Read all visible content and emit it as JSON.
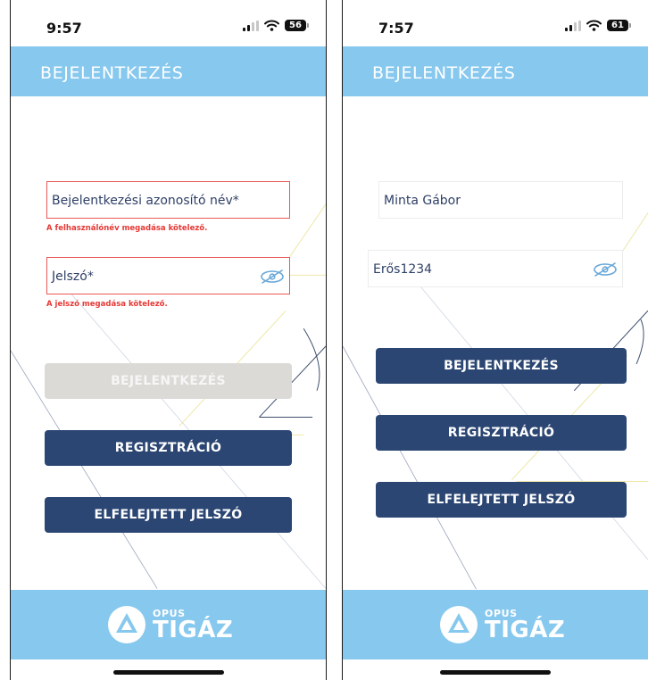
{
  "colors": {
    "header_bg": "#87c8ee",
    "button_primary": "#2b4673",
    "button_disabled": "#dcdad6",
    "error": "#e53935",
    "input_text": "#2e3f66"
  },
  "left": {
    "status": {
      "time": "9:57",
      "battery": "56"
    },
    "header": {
      "title": "BEJELENTKEZÉS"
    },
    "username": {
      "value": "Bejelentkezési azonosító név*",
      "error": "A felhasználónév megadása kötelező."
    },
    "password": {
      "value": "Jelszó*",
      "error": "A jelszó megadása kötelező.",
      "icon": "eye-slash-icon"
    },
    "buttons": {
      "login": "BEJELENTKEZÉS",
      "register": "REGISZTRÁCIÓ",
      "forgot": "ELFELEJTETT JELSZÓ"
    },
    "footer": {
      "logo_small": "OPUS",
      "logo_big": "TIGÁZ"
    }
  },
  "right": {
    "status": {
      "time": "7:57",
      "battery": "61"
    },
    "header": {
      "title": "BEJELENTKEZÉS"
    },
    "username": {
      "value": "Minta Gábor"
    },
    "password": {
      "value": "Erős1234",
      "icon": "eye-slash-icon"
    },
    "buttons": {
      "login": "BEJELENTKEZÉS",
      "register": "REGISZTRÁCIÓ",
      "forgot": "ELFELEJTETT JELSZÓ"
    },
    "footer": {
      "logo_small": "OPUS",
      "logo_big": "TIGÁZ"
    }
  }
}
